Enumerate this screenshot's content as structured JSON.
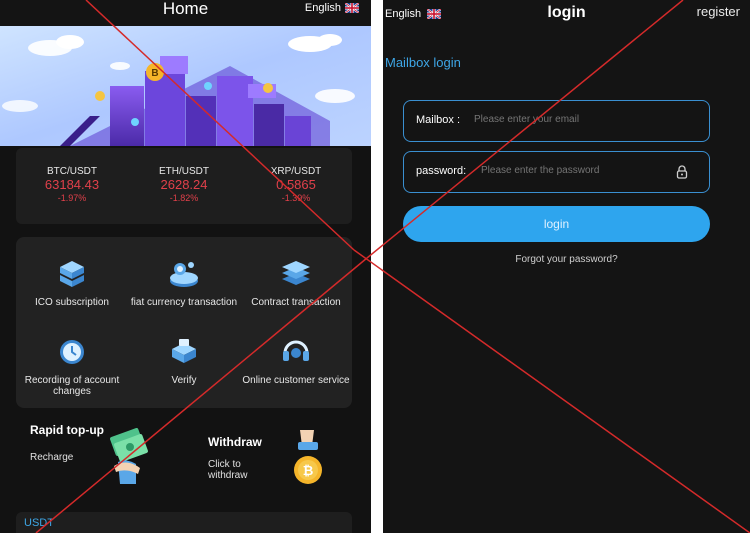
{
  "home": {
    "title": "Home",
    "language": "English",
    "tickers": [
      {
        "pair": "BTC/USDT",
        "price": "63184.43",
        "change": "-1.97%"
      },
      {
        "pair": "ETH/USDT",
        "price": "2628.24",
        "change": "-1.82%"
      },
      {
        "pair": "XRP/USDT",
        "price": "0.5865",
        "change": "-1.39%"
      }
    ],
    "menu": [
      {
        "label": "ICO subscription",
        "icon": "server-stack-icon"
      },
      {
        "label": "fiat currency transaction",
        "icon": "coin-exchange-icon"
      },
      {
        "label": "Contract transaction",
        "icon": "layers-icon"
      },
      {
        "label": "Recording of account changes",
        "icon": "clock-icon"
      },
      {
        "label": "Verify",
        "icon": "id-card-icon"
      },
      {
        "label": "Online customer service",
        "icon": "headset-icon"
      }
    ],
    "rapid": {
      "title": "Rapid top-up",
      "subtitle": "Recharge"
    },
    "withdraw": {
      "title": "Withdraw",
      "subtitle": "Click to withdraw"
    },
    "usdt_label": "USDT"
  },
  "login": {
    "language": "English",
    "title": "login",
    "register": "register",
    "mailbox_title": "Mailbox login",
    "mailbox_label": "Mailbox :",
    "mailbox_placeholder": "Please enter your email",
    "password_label": "password:",
    "password_placeholder": "Please enter the password",
    "button": "login",
    "forgot": "Forgot your password?"
  },
  "colors": {
    "accent": "#2ea5ee",
    "negative": "#e0404a",
    "background": "#141414",
    "cross": "#d42a2a"
  }
}
